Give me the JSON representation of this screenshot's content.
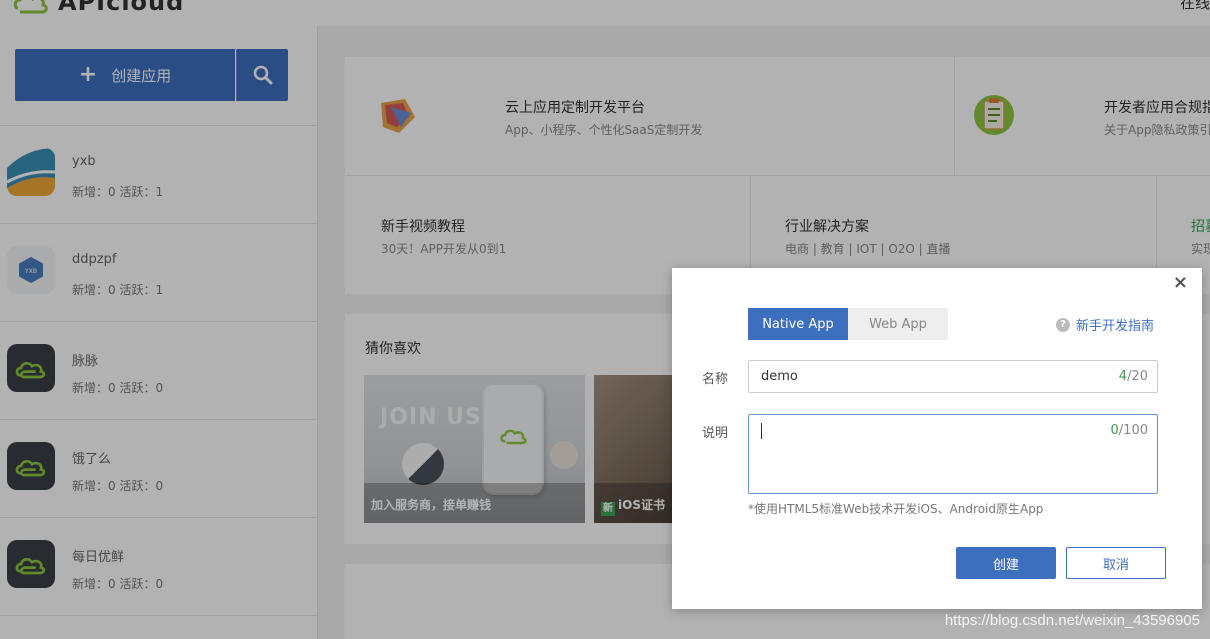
{
  "header": {
    "logo_text": "APIcloud",
    "right_text": "在线"
  },
  "sidebar": {
    "create_label": "创建应用",
    "apps": [
      {
        "name": "yxb",
        "stats": "新增：0  活跃：1",
        "icon": "yxb-app-icon"
      },
      {
        "name": "ddpzpf",
        "stats": "新增：0  活跃：1",
        "icon": "ddpzpf-hexagon-icon",
        "icon_text": "YXB"
      },
      {
        "name": "脉脉",
        "stats": "新增：0  活跃：0",
        "icon": "apicloud-cloud-icon"
      },
      {
        "name": "饿了么",
        "stats": "新增：0  活跃：0",
        "icon": "apicloud-cloud-icon"
      },
      {
        "name": "每日优鲜",
        "stats": "新增：0  活跃：0",
        "icon": "apicloud-cloud-icon"
      }
    ]
  },
  "main": {
    "banner1": [
      {
        "title": "云上应用定制开发平台",
        "sub": "App、小程序、个性化SaaS定制开发"
      },
      {
        "title": "开发者应用合规指",
        "sub": "关于App隐私政策引"
      }
    ],
    "banner2": [
      {
        "title": "新手视频教程",
        "sub": "30天！APP开发从0到1"
      },
      {
        "title": "行业解决方案",
        "sub": "电商 | 教育 | IOT | O2O | 直播"
      },
      {
        "title": "招募",
        "sub": "实现"
      }
    ],
    "guess_title": "猜你喜欢",
    "tiles": [
      {
        "caption": "加入服务商，接单赚钱",
        "overlay": "JOIN US"
      },
      {
        "caption": "iOS证书",
        "badge": "新"
      }
    ]
  },
  "dialog": {
    "tabs": [
      {
        "label": "Native App",
        "active": true
      },
      {
        "label": "Web App",
        "active": false
      }
    ],
    "guide_label": "新手开发指南",
    "name_label": "名称",
    "name_value": "demo",
    "name_count": "4",
    "name_max": "/20",
    "desc_label": "说明",
    "desc_count": "0",
    "desc_max": "/100",
    "hint": "*使用HTML5标准Web技术开发iOS、Android原生App",
    "create_label": "创建",
    "cancel_label": "取消",
    "close_symbol": "×"
  },
  "watermark": "https://blog.csdn.net/weixin_43596905",
  "colors": {
    "primary": "#3d6fbf",
    "counter_green": "#3a9a4a",
    "logo_green": "#8cc63f"
  }
}
